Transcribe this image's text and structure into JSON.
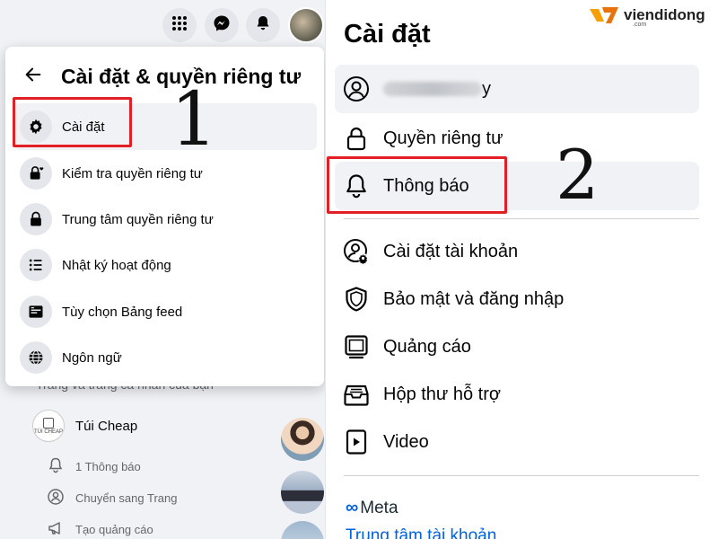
{
  "left_panel": {
    "topbar": {
      "menu_icon": "grid-icon",
      "messenger_icon": "messenger-icon",
      "notifications_icon": "bell-icon"
    },
    "background": {
      "section_label": "Trang và trang cá nhân của bạn",
      "page_name": "Túi Cheap",
      "page_logo_text": "TÚI CHEAP",
      "sub_items": [
        {
          "label": "1 Thông báo",
          "icon": "bell-outline-icon"
        },
        {
          "label": "Chuyển sang Trang",
          "icon": "switch-profile-icon"
        },
        {
          "label": "Tạo quảng cáo",
          "icon": "megaphone-icon"
        }
      ]
    },
    "dropdown": {
      "title": "Cài đặt & quyền riêng tư",
      "items": [
        {
          "label": "Cài đặt",
          "icon": "gear-icon"
        },
        {
          "label": "Kiểm tra quyền riêng tư",
          "icon": "lock-heart-icon"
        },
        {
          "label": "Trung tâm quyền riêng tư",
          "icon": "lock-icon"
        },
        {
          "label": "Nhật ký hoạt động",
          "icon": "list-icon"
        },
        {
          "label": "Tùy chọn Bảng feed",
          "icon": "feed-icon"
        },
        {
          "label": "Ngôn ngữ",
          "icon": "globe-icon"
        }
      ]
    }
  },
  "right_panel": {
    "title": "Cài đặt",
    "items": [
      {
        "label": "y",
        "icon": "profile-icon"
      },
      {
        "label": "Quyền riêng tư",
        "icon": "lock-outline-icon"
      },
      {
        "label": "Thông báo",
        "icon": "bell-outline-icon"
      },
      {
        "label": "Cài đặt tài khoản",
        "icon": "account-settings-icon"
      },
      {
        "label": "Bảo mật và đăng nhập",
        "icon": "shield-icon"
      },
      {
        "label": "Quảng cáo",
        "icon": "ads-icon"
      },
      {
        "label": "Hộp thư hỗ trợ",
        "icon": "inbox-icon"
      },
      {
        "label": "Video",
        "icon": "video-icon"
      }
    ],
    "meta_label": "Meta",
    "accounts_center_link": "Trung tâm tài khoản"
  },
  "annotations": {
    "step1": "1",
    "step2": "2",
    "highlight_color": "#e31f26"
  },
  "watermark": {
    "brand": "viendidong",
    "domain": ".com"
  },
  "colors": {
    "meta_blue": "#0064e0",
    "panel_bg": "#f0f2f5",
    "icon_bg": "#e4e6eb"
  }
}
